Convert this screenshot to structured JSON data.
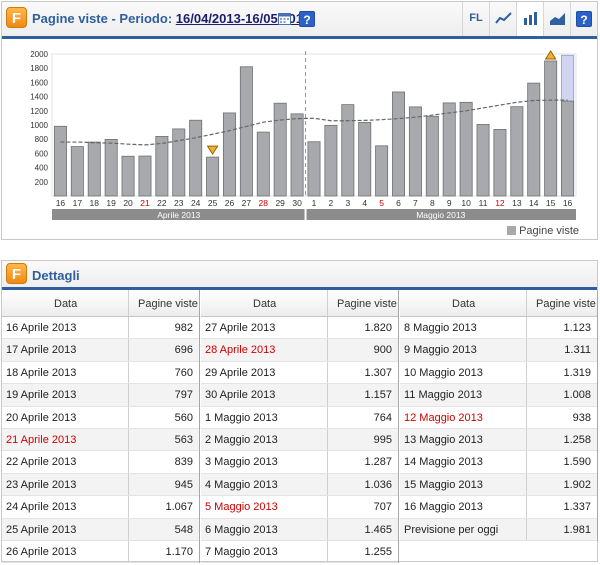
{
  "chart_panel": {
    "title_prefix": "Pagine viste - Periodo:",
    "period": "16/04/2013-16/05/2013",
    "toolbar": {
      "fl_label": "FL"
    }
  },
  "chart_data": {
    "type": "bar",
    "categories": [
      "16",
      "17",
      "18",
      "19",
      "20",
      "21",
      "22",
      "23",
      "24",
      "25",
      "26",
      "27",
      "28",
      "29",
      "30",
      "1",
      "2",
      "3",
      "4",
      "5",
      "6",
      "7",
      "8",
      "9",
      "10",
      "11",
      "12",
      "13",
      "14",
      "15",
      "16"
    ],
    "red_categories_index": [
      5,
      12,
      19,
      26
    ],
    "values": [
      982,
      696,
      760,
      797,
      560,
      563,
      839,
      945,
      1067,
      548,
      1170,
      1820,
      900,
      1307,
      1157,
      764,
      995,
      1287,
      1036,
      707,
      1465,
      1255,
      1123,
      1311,
      1319,
      1008,
      938,
      1258,
      1590,
      1902,
      1337
    ],
    "forecast_last": 1981,
    "trend": [
      760,
      760,
      750,
      745,
      730,
      720,
      740,
      780,
      820,
      870,
      920,
      980,
      1040,
      1070,
      1090,
      1095,
      1060,
      1060,
      1065,
      1075,
      1090,
      1110,
      1140,
      1170,
      1200,
      1240,
      1280,
      1320,
      1345,
      1350,
      1350
    ],
    "ylim": [
      0,
      2000
    ],
    "yticks": [
      200,
      400,
      600,
      800,
      1000,
      1200,
      1400,
      1600,
      1800,
      2000
    ],
    "month_groups": [
      "Aprile 2013",
      "Maggio 2013"
    ],
    "legend": "Pagine viste",
    "colors": {
      "bar": "#a8a9ad",
      "bar_edge": "#6f7073",
      "forecast": "#d0d6f2",
      "trend": "#666666",
      "separator": "#7a93d8"
    }
  },
  "details": {
    "title": "Dettagli",
    "header_data": "Data",
    "header_value": "Pagine viste",
    "columns": [
      [
        {
          "date": "16 Aprile 2013",
          "value": "982",
          "red": false
        },
        {
          "date": "17 Aprile 2013",
          "value": "696",
          "red": false
        },
        {
          "date": "18 Aprile 2013",
          "value": "760",
          "red": false
        },
        {
          "date": "19 Aprile 2013",
          "value": "797",
          "red": false
        },
        {
          "date": "20 Aprile 2013",
          "value": "560",
          "red": false
        },
        {
          "date": "21 Aprile 2013",
          "value": "563",
          "red": true
        },
        {
          "date": "22 Aprile 2013",
          "value": "839",
          "red": false
        },
        {
          "date": "23 Aprile 2013",
          "value": "945",
          "red": false
        },
        {
          "date": "24 Aprile 2013",
          "value": "1.067",
          "red": false
        },
        {
          "date": "25 Aprile 2013",
          "value": "548",
          "red": false
        },
        {
          "date": "26 Aprile 2013",
          "value": "1.170",
          "red": false
        }
      ],
      [
        {
          "date": "27 Aprile 2013",
          "value": "1.820",
          "red": false
        },
        {
          "date": "28 Aprile 2013",
          "value": "900",
          "red": true
        },
        {
          "date": "29 Aprile 2013",
          "value": "1.307",
          "red": false
        },
        {
          "date": "30 Aprile 2013",
          "value": "1.157",
          "red": false
        },
        {
          "date": "1 Maggio 2013",
          "value": "764",
          "red": false
        },
        {
          "date": "2 Maggio 2013",
          "value": "995",
          "red": false
        },
        {
          "date": "3 Maggio 2013",
          "value": "1.287",
          "red": false
        },
        {
          "date": "4 Maggio 2013",
          "value": "1.036",
          "red": false
        },
        {
          "date": "5 Maggio 2013",
          "value": "707",
          "red": true
        },
        {
          "date": "6 Maggio 2013",
          "value": "1.465",
          "red": false
        },
        {
          "date": "7 Maggio 2013",
          "value": "1.255",
          "red": false
        }
      ],
      [
        {
          "date": "8 Maggio 2013",
          "value": "1.123",
          "red": false
        },
        {
          "date": "9 Maggio 2013",
          "value": "1.311",
          "red": false
        },
        {
          "date": "10 Maggio 2013",
          "value": "1.319",
          "red": false
        },
        {
          "date": "11 Maggio 2013",
          "value": "1.008",
          "red": false
        },
        {
          "date": "12 Maggio 2013",
          "value": "938",
          "red": true
        },
        {
          "date": "13 Maggio 2013",
          "value": "1.258",
          "red": false
        },
        {
          "date": "14 Maggio 2013",
          "value": "1.590",
          "red": false
        },
        {
          "date": "15 Maggio 2013",
          "value": "1.902",
          "red": false
        },
        {
          "date": "16 Maggio 2013",
          "value": "1.337",
          "red": false
        },
        {
          "date": "Previsione per oggi",
          "value": "1.981",
          "red": false
        }
      ]
    ]
  }
}
